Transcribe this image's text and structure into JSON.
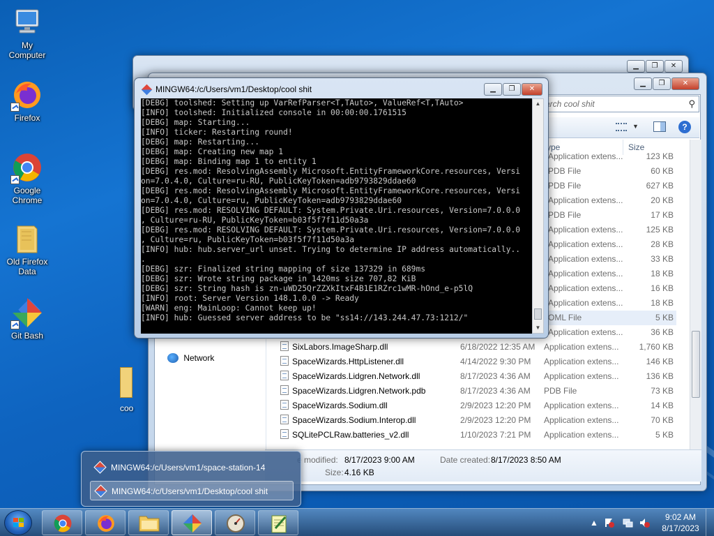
{
  "desktop": {
    "icons": [
      {
        "label": "My Computer"
      },
      {
        "label": "Firefox"
      },
      {
        "label": "Google Chrome"
      },
      {
        "label": "Old Firefox Data"
      },
      {
        "label": "Git Bash"
      }
    ],
    "partial_icon_label": "coo"
  },
  "explorer": {
    "search_placeholder": "arch cool shit",
    "columns": {
      "type": "ype",
      "size": "Size"
    },
    "upper_rows": [
      {
        "type": "Application extens...",
        "size": "123 KB"
      },
      {
        "type": "PDB File",
        "size": "60 KB"
      },
      {
        "type": "PDB File",
        "size": "627 KB"
      },
      {
        "type": "Application extens...",
        "size": "20 KB"
      },
      {
        "type": "PDB File",
        "size": "17 KB"
      },
      {
        "type": "Application extens...",
        "size": "125 KB"
      },
      {
        "type": "Application extens...",
        "size": "28 KB"
      },
      {
        "type": "Application extens...",
        "size": "33 KB"
      },
      {
        "type": "Application extens...",
        "size": "18 KB"
      },
      {
        "type": "Application extens...",
        "size": "16 KB"
      },
      {
        "type": "Application extens...",
        "size": "18 KB"
      },
      {
        "type": "OML File",
        "size": "5 KB"
      },
      {
        "type": "Application extens...",
        "size": "36 KB"
      }
    ],
    "nav_network": "Network",
    "files": [
      {
        "name": "SixLabors.ImageSharp.dll",
        "date": "6/18/2022 12:35 AM",
        "type": "Application extens...",
        "size": "1,760 KB"
      },
      {
        "name": "SpaceWizards.HttpListener.dll",
        "date": "4/14/2022 9:30 PM",
        "type": "Application extens...",
        "size": "146 KB"
      },
      {
        "name": "SpaceWizards.Lidgren.Network.dll",
        "date": "8/17/2023 4:36 AM",
        "type": "Application extens...",
        "size": "136 KB"
      },
      {
        "name": "SpaceWizards.Lidgren.Network.pdb",
        "date": "8/17/2023 4:36 AM",
        "type": "PDB File",
        "size": "73 KB"
      },
      {
        "name": "SpaceWizards.Sodium.dll",
        "date": "2/9/2023 12:20 PM",
        "type": "Application extens...",
        "size": "14 KB"
      },
      {
        "name": "SpaceWizards.Sodium.Interop.dll",
        "date": "2/9/2023 12:20 PM",
        "type": "Application extens...",
        "size": "70 KB"
      },
      {
        "name": "SQLitePCLRaw.batteries_v2.dll",
        "date": "1/10/2023 7:21 PM",
        "type": "Application extens...",
        "size": "5 KB"
      }
    ],
    "details": {
      "modified_label": "e modified:",
      "modified_value": "8/17/2023 9:00 AM",
      "created_label": "Date created:",
      "created_value": "8/17/2023 8:50 AM",
      "size_label": "Size:",
      "size_value": "4.16 KB"
    }
  },
  "console": {
    "title": "MINGW64:/c/Users/vm1/Desktop/cool shit",
    "lines": [
      "[DEBG] toolshed: Setting up VarRefParser<T,TAuto>, ValueRef<T,TAuto>",
      "[INFO] toolshed: Initialized console in 00:00:00.1761515",
      "[DEBG] map: Starting...",
      "[INFO] ticker: Restarting round!",
      "[DEBG] map: Restarting...",
      "[DEBG] map: Creating new map 1",
      "[DEBG] map: Binding map 1 to entity 1",
      "[DEBG] res.mod: ResolvingAssembly Microsoft.EntityFrameworkCore.resources, Versi",
      "on=7.0.4.0, Culture=ru-RU, PublicKeyToken=adb9793829ddae60",
      "[DEBG] res.mod: ResolvingAssembly Microsoft.EntityFrameworkCore.resources, Versi",
      "on=7.0.4.0, Culture=ru, PublicKeyToken=adb9793829ddae60",
      "[DEBG] res.mod: RESOLVING DEFAULT: System.Private.Uri.resources, Version=7.0.0.0",
      ", Culture=ru-RU, PublicKeyToken=b03f5f7f11d50a3a",
      "[DEBG] res.mod: RESOLVING DEFAULT: System.Private.Uri.resources, Version=7.0.0.0",
      ", Culture=ru, PublicKeyToken=b03f5f7f11d50a3a",
      "[INFO] hub: hub.server_url unset. Trying to determine IP address automatically..",
      ".",
      "[DEBG] szr: Finalized string mapping of size 137329 in 689ms",
      "[DEBG] szr: Wrote string package in 1420ms size 707,82 KiB",
      "[DEBG] szr: String hash is zn-uWD25QrZZXkItxF4B1E1RZrc1wMR-hOnd_e-p5lQ",
      "[INFO] root: Server Version 148.1.0.0 -> Ready",
      "[WARN] eng: MainLoop: Cannot keep up!",
      "[INFO] hub: Guessed server address to be \"ss14://143.244.47.73:1212/\""
    ]
  },
  "jumplist": {
    "items": [
      "MINGW64:/c/Users/vm1/space-station-14",
      "MINGW64:/c/Users/vm1/Desktop/cool shit"
    ]
  },
  "taskbar": {
    "time": "9:02 AM",
    "date": "8/17/2023"
  },
  "colors": {
    "desktop_blue": "#1574d2",
    "console_bg": "#000000",
    "console_fg": "#c8c8c8"
  }
}
